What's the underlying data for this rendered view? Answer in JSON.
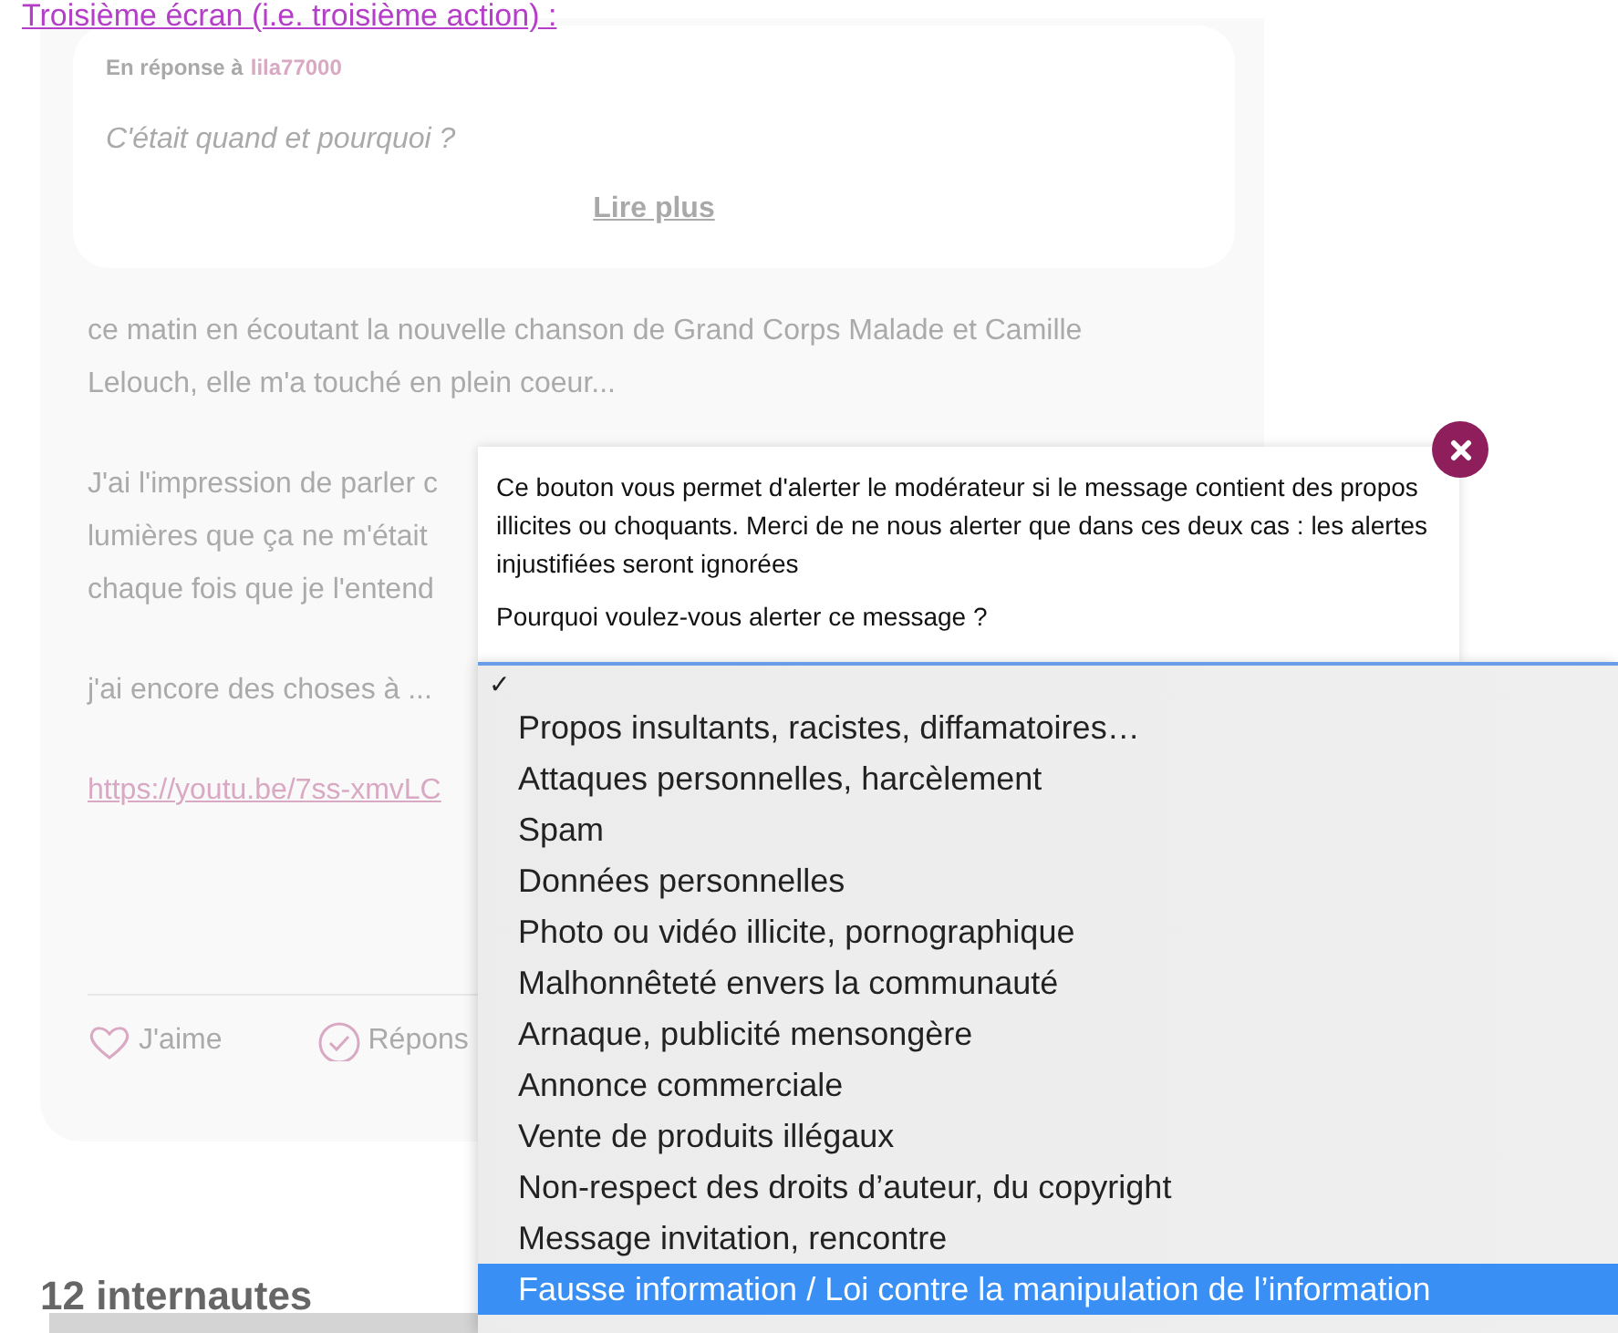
{
  "header_link": "Troisième écran (i.e. troisième action) :",
  "post": {
    "reply_to": {
      "label": "En réponse à",
      "user": "lila77000",
      "quote": "C'était quand et pourquoi ?",
      "more_link": "Lire plus"
    },
    "paragraphs": [
      [
        "ce matin en écoutant la nouvelle chanson de Grand Corps Malade et Camille",
        "Lelouch, elle m'a touché en plein coeur..."
      ],
      [
        "J'ai l'impression de parler c",
        "lumières que ça ne m'était",
        "chaque fois que je l'entend"
      ],
      [
        "j'ai encore des choses à ..."
      ]
    ],
    "link": "https://youtu.be/7ss-xmvLC",
    "actions": [
      {
        "kind": "like",
        "label": "J'aime"
      },
      {
        "kind": "reply",
        "label": "Répons"
      }
    ]
  },
  "comments_heading": "12 internautes",
  "alert_dialog": {
    "message": "Ce bouton vous permet d'alerter le modérateur si le message contient des propos illicites ou choquants. Merci de ne nous alerter que dans ces deux cas : les alertes injustifiées seront ignorées",
    "question": "Pourquoi voulez-vous alerter ce message ?",
    "dropdown": {
      "check": "✓",
      "options": [
        {
          "label": "Propos insultants, racistes, diffamatoires…",
          "selected": false
        },
        {
          "label": "Attaques personnelles, harcèlement",
          "selected": false
        },
        {
          "label": "Spam",
          "selected": false
        },
        {
          "label": "Données personnelles",
          "selected": false
        },
        {
          "label": "Photo ou vidéo illicite, pornographique",
          "selected": false
        },
        {
          "label": "Malhonnêteté envers la communauté",
          "selected": false
        },
        {
          "label": "Arnaque, publicité mensongère",
          "selected": false
        },
        {
          "label": "Annonce commerciale",
          "selected": false
        },
        {
          "label": "Vente de produits illégaux",
          "selected": false
        },
        {
          "label": "Non-respect des droits d’auteur, du copyright",
          "selected": false
        },
        {
          "label": "Message invitation, rencontre",
          "selected": false
        },
        {
          "label": "Fausse information / Loi contre la manipulation de l’information",
          "selected": true
        }
      ]
    }
  }
}
